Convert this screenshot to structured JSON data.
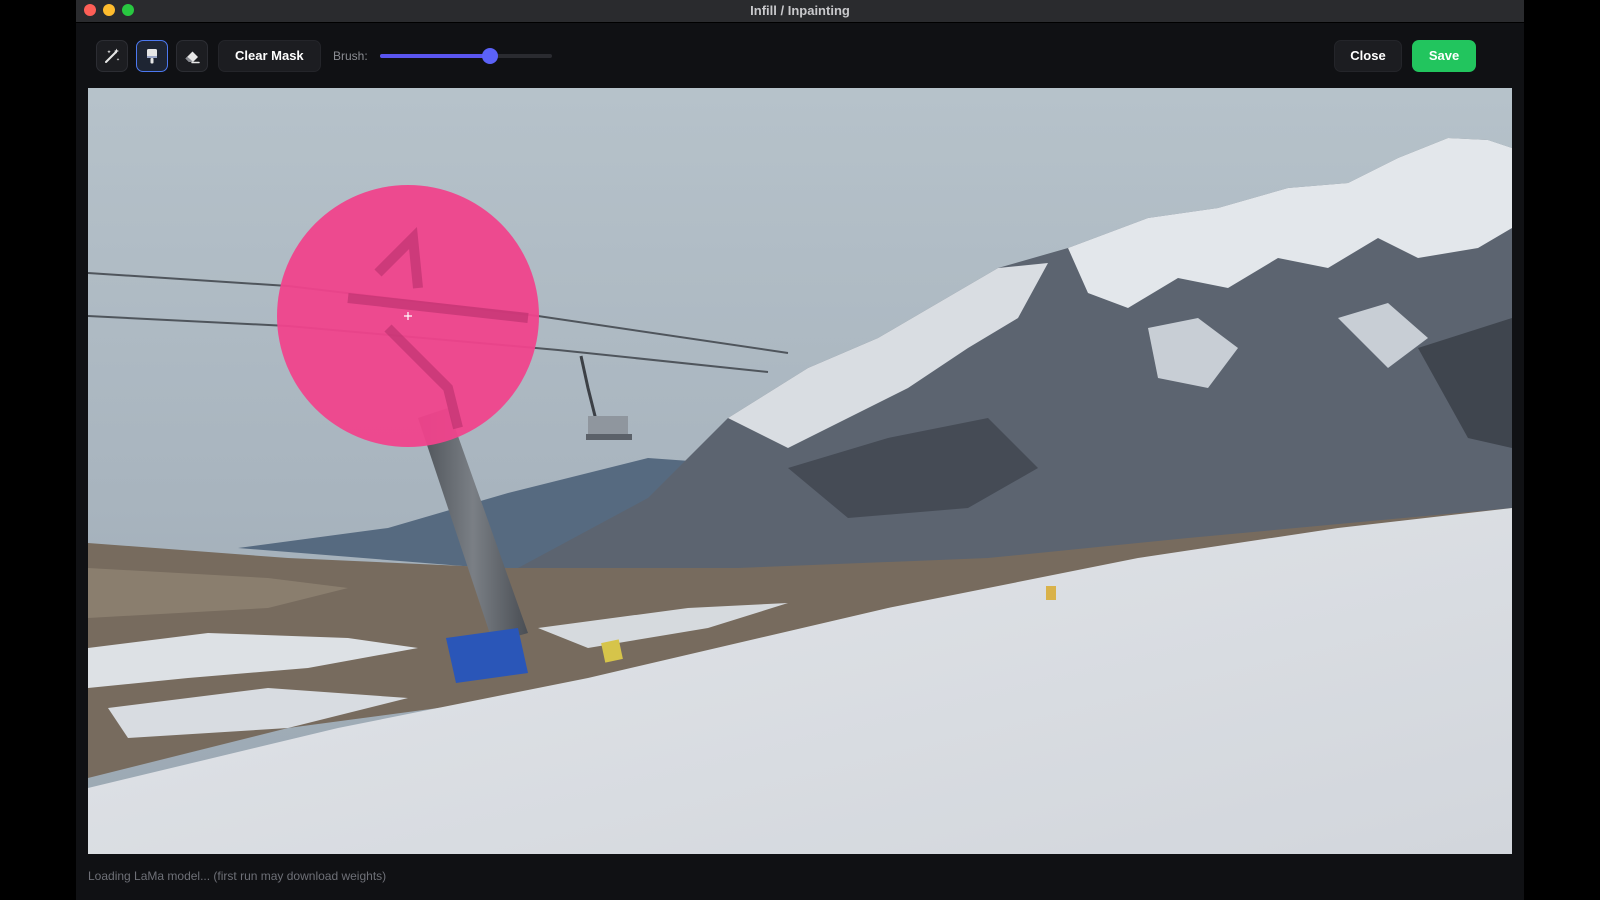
{
  "window": {
    "title": "Infill / Inpainting"
  },
  "toolbar": {
    "tools": [
      {
        "icon": "magic-wand-icon",
        "active": false
      },
      {
        "icon": "brush-icon",
        "active": true
      },
      {
        "icon": "eraser-icon",
        "active": false
      }
    ],
    "clear_mask_label": "Clear Mask",
    "brush_label": "Brush:",
    "brush_size_fraction": 0.64,
    "close_label": "Close",
    "save_label": "Save"
  },
  "colors": {
    "accent": "#5b62f7",
    "save": "#22c55e",
    "mask": "#f0438c"
  },
  "status": {
    "text": "Loading LaMa model... (first run may download weights)"
  }
}
